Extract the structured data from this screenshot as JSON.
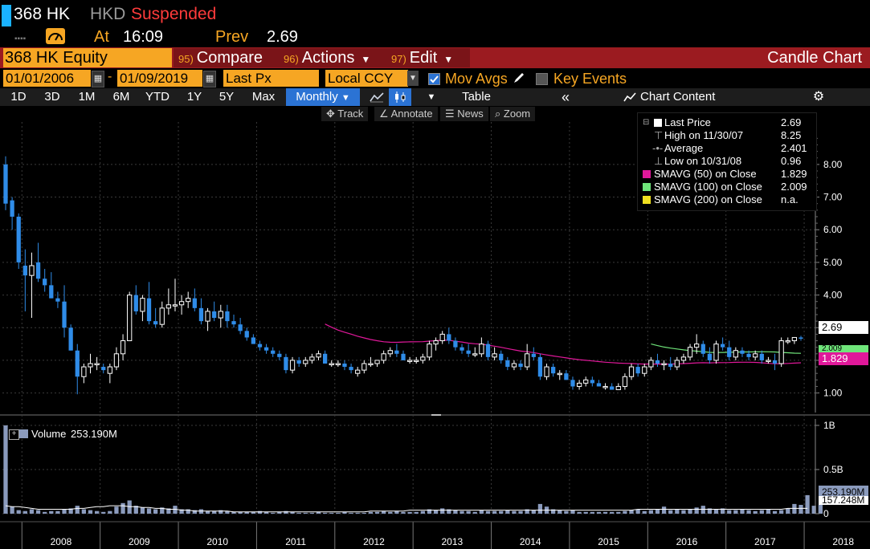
{
  "header": {
    "ticker": "368 HK",
    "currency": "HKD",
    "status": "Suspended",
    "at_label": "At",
    "time": "16:09",
    "prev_label": "Prev",
    "prev_value": "2.69",
    "status_color": "#ff3b3b"
  },
  "menu": {
    "security": "368 HK Equity",
    "compare_num": "95)",
    "compare": "Compare",
    "actions_num": "96)",
    "actions": "Actions",
    "edit_num": "97)",
    "edit": "Edit",
    "chart_title": "Candle Chart"
  },
  "controls": {
    "start_date": "01/01/2006",
    "dash": "-",
    "end_date": "01/09/2019",
    "price_field": "Last Px",
    "currency_field": "Local CCY",
    "mov_avgs": "Mov Avgs",
    "key_events": "Key Events"
  },
  "toolbar": {
    "ranges": [
      "1D",
      "3D",
      "1M",
      "6M",
      "YTD",
      "1Y",
      "5Y",
      "Max"
    ],
    "period": "Monthly",
    "table": "Table",
    "chart_content": "Chart Content"
  },
  "tools": {
    "track": "Track",
    "annotate": "Annotate",
    "news": "News",
    "zoom": "Zoom"
  },
  "legend": [
    {
      "label": "Last Price",
      "value": "2.69",
      "color": ""
    },
    {
      "label": "High on 11/30/07",
      "value": "8.25",
      "color": ""
    },
    {
      "label": "Average",
      "value": "2.401",
      "color": ""
    },
    {
      "label": "Low on 10/31/08",
      "value": "0.96",
      "color": ""
    },
    {
      "label": "SMAVG (50)  on Close",
      "value": "1.829",
      "color": "#e0189a"
    },
    {
      "label": "SMAVG (100)  on Close",
      "value": "2.009",
      "color": "#6fe57a"
    },
    {
      "label": "SMAVG (200)  on Close",
      "value": "n.a.",
      "color": "#f0e020"
    }
  ],
  "price_tags": {
    "last": "2.69",
    "sma100": "2.009",
    "sma50": "1.829"
  },
  "volume": {
    "label": "Volume",
    "value": "253.190M",
    "avg_tag": "157.248M",
    "axis": [
      "1B",
      "0.5B",
      "0"
    ]
  },
  "chart_data": {
    "type": "candlestick",
    "period": "Monthly",
    "y_axis_ticks": [
      "1.00",
      "2.00",
      "3.00",
      "4.00",
      "5.00",
      "6.00",
      "7.00",
      "8.00"
    ],
    "ylim": [
      0.4,
      9.3
    ],
    "x_labels": [
      "2008",
      "2009",
      "2010",
      "2011",
      "2012",
      "2013",
      "2014",
      "2015",
      "2016",
      "2017",
      "2018"
    ],
    "x_start": "2007-10",
    "candles": [
      {
        "o": 8.0,
        "h": 8.25,
        "l": 6.6,
        "c": 6.8
      },
      {
        "o": 6.9,
        "h": 7.0,
        "l": 6.0,
        "c": 6.4
      },
      {
        "o": 6.4,
        "h": 6.5,
        "l": 4.8,
        "c": 5.0
      },
      {
        "o": 4.9,
        "h": 5.4,
        "l": 3.5,
        "c": 4.6
      },
      {
        "o": 4.6,
        "h": 5.3,
        "l": 3.3,
        "c": 4.9
      },
      {
        "o": 5.0,
        "h": 5.6,
        "l": 4.4,
        "c": 4.5
      },
      {
        "o": 4.5,
        "h": 4.8,
        "l": 4.1,
        "c": 4.3
      },
      {
        "o": 4.3,
        "h": 4.7,
        "l": 3.9,
        "c": 3.9
      },
      {
        "o": 3.9,
        "h": 4.1,
        "l": 3.6,
        "c": 3.8
      },
      {
        "o": 3.8,
        "h": 4.3,
        "l": 2.7,
        "c": 3.0
      },
      {
        "o": 3.0,
        "h": 3.1,
        "l": 2.3,
        "c": 2.3
      },
      {
        "o": 2.3,
        "h": 2.5,
        "l": 0.96,
        "c": 1.5
      },
      {
        "o": 1.5,
        "h": 1.9,
        "l": 1.3,
        "c": 1.8
      },
      {
        "o": 1.8,
        "h": 2.2,
        "l": 1.6,
        "c": 1.9
      },
      {
        "o": 1.9,
        "h": 2.1,
        "l": 1.7,
        "c": 1.9
      },
      {
        "o": 1.8,
        "h": 1.9,
        "l": 1.6,
        "c": 1.7
      },
      {
        "o": 1.6,
        "h": 1.9,
        "l": 1.3,
        "c": 1.8
      },
      {
        "o": 1.8,
        "h": 2.4,
        "l": 1.7,
        "c": 2.2
      },
      {
        "o": 2.2,
        "h": 2.8,
        "l": 2.0,
        "c": 2.6
      },
      {
        "o": 2.6,
        "h": 4.1,
        "l": 2.6,
        "c": 4.0
      },
      {
        "o": 4.0,
        "h": 4.3,
        "l": 3.4,
        "c": 3.5
      },
      {
        "o": 3.5,
        "h": 4.0,
        "l": 3.2,
        "c": 3.9
      },
      {
        "o": 3.9,
        "h": 4.4,
        "l": 3.1,
        "c": 3.2
      },
      {
        "o": 3.2,
        "h": 3.6,
        "l": 3.0,
        "c": 3.1
      },
      {
        "o": 3.1,
        "h": 3.8,
        "l": 3.0,
        "c": 3.6
      },
      {
        "o": 3.6,
        "h": 4.2,
        "l": 3.4,
        "c": 3.7
      },
      {
        "o": 3.7,
        "h": 4.5,
        "l": 3.5,
        "c": 3.7
      },
      {
        "o": 3.7,
        "h": 4.0,
        "l": 3.4,
        "c": 3.8
      },
      {
        "o": 3.8,
        "h": 4.1,
        "l": 3.6,
        "c": 3.9
      },
      {
        "o": 3.9,
        "h": 4.2,
        "l": 3.5,
        "c": 3.6
      },
      {
        "o": 3.6,
        "h": 3.9,
        "l": 3.1,
        "c": 3.2
      },
      {
        "o": 3.2,
        "h": 3.6,
        "l": 2.9,
        "c": 3.5
      },
      {
        "o": 3.5,
        "h": 3.8,
        "l": 3.2,
        "c": 3.3
      },
      {
        "o": 3.3,
        "h": 3.7,
        "l": 3.0,
        "c": 3.5
      },
      {
        "o": 3.5,
        "h": 3.7,
        "l": 3.0,
        "c": 3.2
      },
      {
        "o": 3.2,
        "h": 3.4,
        "l": 3.0,
        "c": 3.1
      },
      {
        "o": 3.1,
        "h": 3.3,
        "l": 2.8,
        "c": 2.9
      },
      {
        "o": 2.9,
        "h": 3.0,
        "l": 2.6,
        "c": 2.7
      },
      {
        "o": 2.7,
        "h": 2.8,
        "l": 2.5,
        "c": 2.5
      },
      {
        "o": 2.5,
        "h": 2.6,
        "l": 2.3,
        "c": 2.4
      },
      {
        "o": 2.4,
        "h": 2.5,
        "l": 2.2,
        "c": 2.3
      },
      {
        "o": 2.3,
        "h": 2.4,
        "l": 2.1,
        "c": 2.2
      },
      {
        "o": 2.2,
        "h": 2.3,
        "l": 2.0,
        "c": 2.1
      },
      {
        "o": 2.1,
        "h": 2.2,
        "l": 1.6,
        "c": 1.7
      },
      {
        "o": 1.7,
        "h": 2.1,
        "l": 1.6,
        "c": 2.0
      },
      {
        "o": 2.0,
        "h": 2.1,
        "l": 1.8,
        "c": 1.9
      },
      {
        "o": 1.9,
        "h": 2.1,
        "l": 1.8,
        "c": 2.0
      },
      {
        "o": 2.0,
        "h": 2.2,
        "l": 1.9,
        "c": 2.1
      },
      {
        "o": 2.1,
        "h": 2.3,
        "l": 2.0,
        "c": 2.2
      },
      {
        "o": 2.2,
        "h": 2.3,
        "l": 1.9,
        "c": 1.9
      },
      {
        "o": 1.9,
        "h": 2.0,
        "l": 1.8,
        "c": 1.9
      },
      {
        "o": 1.9,
        "h": 2.0,
        "l": 1.8,
        "c": 1.9
      },
      {
        "o": 1.9,
        "h": 2.0,
        "l": 1.7,
        "c": 1.8
      },
      {
        "o": 1.8,
        "h": 1.9,
        "l": 1.6,
        "c": 1.7
      },
      {
        "o": 1.6,
        "h": 1.8,
        "l": 1.5,
        "c": 1.7
      },
      {
        "o": 1.7,
        "h": 2.0,
        "l": 1.6,
        "c": 1.9
      },
      {
        "o": 1.9,
        "h": 2.1,
        "l": 1.8,
        "c": 1.9
      },
      {
        "o": 1.9,
        "h": 2.0,
        "l": 1.8,
        "c": 2.0
      },
      {
        "o": 2.0,
        "h": 2.3,
        "l": 1.9,
        "c": 2.2
      },
      {
        "o": 2.2,
        "h": 2.4,
        "l": 2.1,
        "c": 2.3
      },
      {
        "o": 2.3,
        "h": 2.5,
        "l": 2.1,
        "c": 2.2
      },
      {
        "o": 2.2,
        "h": 2.3,
        "l": 2.0,
        "c": 2.0
      },
      {
        "o": 2.0,
        "h": 2.1,
        "l": 1.9,
        "c": 2.0
      },
      {
        "o": 2.0,
        "h": 2.1,
        "l": 1.9,
        "c": 2.0
      },
      {
        "o": 2.0,
        "h": 2.2,
        "l": 1.9,
        "c": 2.1
      },
      {
        "o": 2.1,
        "h": 2.6,
        "l": 2.0,
        "c": 2.5
      },
      {
        "o": 2.5,
        "h": 2.7,
        "l": 2.3,
        "c": 2.6
      },
      {
        "o": 2.6,
        "h": 2.9,
        "l": 2.5,
        "c": 2.8
      },
      {
        "o": 2.8,
        "h": 3.0,
        "l": 2.5,
        "c": 2.6
      },
      {
        "o": 2.6,
        "h": 2.7,
        "l": 2.3,
        "c": 2.4
      },
      {
        "o": 2.4,
        "h": 2.5,
        "l": 2.2,
        "c": 2.3
      },
      {
        "o": 2.3,
        "h": 2.5,
        "l": 2.1,
        "c": 2.2
      },
      {
        "o": 2.2,
        "h": 2.4,
        "l": 2.1,
        "c": 2.2
      },
      {
        "o": 2.2,
        "h": 2.7,
        "l": 2.1,
        "c": 2.5
      },
      {
        "o": 2.5,
        "h": 2.6,
        "l": 2.0,
        "c": 2.1
      },
      {
        "o": 2.1,
        "h": 2.4,
        "l": 2.0,
        "c": 2.2
      },
      {
        "o": 2.2,
        "h": 2.3,
        "l": 1.9,
        "c": 2.0
      },
      {
        "o": 2.0,
        "h": 2.1,
        "l": 1.7,
        "c": 1.8
      },
      {
        "o": 1.8,
        "h": 2.0,
        "l": 1.7,
        "c": 1.9
      },
      {
        "o": 1.9,
        "h": 2.0,
        "l": 1.7,
        "c": 1.8
      },
      {
        "o": 1.8,
        "h": 2.5,
        "l": 1.7,
        "c": 2.2
      },
      {
        "o": 2.2,
        "h": 2.4,
        "l": 2.0,
        "c": 2.1
      },
      {
        "o": 2.1,
        "h": 2.2,
        "l": 1.4,
        "c": 1.5
      },
      {
        "o": 1.5,
        "h": 1.9,
        "l": 1.4,
        "c": 1.8
      },
      {
        "o": 1.8,
        "h": 1.9,
        "l": 1.5,
        "c": 1.6
      },
      {
        "o": 1.6,
        "h": 1.7,
        "l": 1.4,
        "c": 1.6
      },
      {
        "o": 1.6,
        "h": 1.7,
        "l": 1.4,
        "c": 1.4
      },
      {
        "o": 1.4,
        "h": 1.5,
        "l": 1.1,
        "c": 1.2
      },
      {
        "o": 1.2,
        "h": 1.4,
        "l": 1.1,
        "c": 1.3
      },
      {
        "o": 1.3,
        "h": 1.5,
        "l": 1.2,
        "c": 1.4
      },
      {
        "o": 1.4,
        "h": 1.5,
        "l": 1.2,
        "c": 1.3
      },
      {
        "o": 1.3,
        "h": 1.4,
        "l": 1.2,
        "c": 1.2
      },
      {
        "o": 1.2,
        "h": 1.3,
        "l": 1.1,
        "c": 1.2
      },
      {
        "o": 1.2,
        "h": 1.3,
        "l": 1.1,
        "c": 1.1
      },
      {
        "o": 1.1,
        "h": 1.3,
        "l": 1.1,
        "c": 1.2
      },
      {
        "o": 1.2,
        "h": 1.6,
        "l": 1.1,
        "c": 1.5
      },
      {
        "o": 1.5,
        "h": 1.9,
        "l": 1.4,
        "c": 1.8
      },
      {
        "o": 1.8,
        "h": 1.9,
        "l": 1.5,
        "c": 1.6
      },
      {
        "o": 1.6,
        "h": 1.9,
        "l": 1.5,
        "c": 1.8
      },
      {
        "o": 1.8,
        "h": 2.1,
        "l": 1.7,
        "c": 2.0
      },
      {
        "o": 2.0,
        "h": 2.2,
        "l": 1.8,
        "c": 1.9
      },
      {
        "o": 1.9,
        "h": 2.0,
        "l": 1.7,
        "c": 1.9
      },
      {
        "o": 1.9,
        "h": 2.1,
        "l": 1.7,
        "c": 1.8
      },
      {
        "o": 1.8,
        "h": 2.1,
        "l": 1.7,
        "c": 2.0
      },
      {
        "o": 2.0,
        "h": 2.2,
        "l": 1.9,
        "c": 2.1
      },
      {
        "o": 2.1,
        "h": 2.5,
        "l": 2.0,
        "c": 2.4
      },
      {
        "o": 2.4,
        "h": 2.8,
        "l": 2.2,
        "c": 2.5
      },
      {
        "o": 2.5,
        "h": 2.6,
        "l": 2.1,
        "c": 2.2
      },
      {
        "o": 2.2,
        "h": 2.4,
        "l": 1.9,
        "c": 2.0
      },
      {
        "o": 2.0,
        "h": 2.6,
        "l": 1.9,
        "c": 2.5
      },
      {
        "o": 2.5,
        "h": 2.7,
        "l": 2.3,
        "c": 2.4
      },
      {
        "o": 2.4,
        "h": 2.6,
        "l": 2.0,
        "c": 2.1
      },
      {
        "o": 2.1,
        "h": 2.4,
        "l": 2.0,
        "c": 2.3
      },
      {
        "o": 2.3,
        "h": 2.4,
        "l": 2.1,
        "c": 2.2
      },
      {
        "o": 2.2,
        "h": 2.3,
        "l": 2.0,
        "c": 2.1
      },
      {
        "o": 2.1,
        "h": 2.3,
        "l": 2.0,
        "c": 2.2
      },
      {
        "o": 2.2,
        "h": 2.3,
        "l": 1.9,
        "c": 2.0
      },
      {
        "o": 2.0,
        "h": 2.1,
        "l": 1.9,
        "c": 2.0
      },
      {
        "o": 2.0,
        "h": 2.2,
        "l": 1.7,
        "c": 1.9
      },
      {
        "o": 1.9,
        "h": 2.7,
        "l": 1.8,
        "c": 2.6
      },
      {
        "o": 2.6,
        "h": 2.7,
        "l": 2.5,
        "c": 2.6
      },
      {
        "o": 2.6,
        "h": 2.7,
        "l": 2.5,
        "c": 2.7
      },
      {
        "o": 2.7,
        "h": 2.75,
        "l": 2.6,
        "c": 2.69
      }
    ],
    "volume_series": [
      1.0,
      0.08,
      0.04,
      0.03,
      0.05,
      0.04,
      0.02,
      0.03,
      0.03,
      0.05,
      0.06,
      0.09,
      0.05,
      0.04,
      0.03,
      0.02,
      0.03,
      0.08,
      0.12,
      0.15,
      0.09,
      0.07,
      0.06,
      0.05,
      0.07,
      0.06,
      0.09,
      0.05,
      0.05,
      0.04,
      0.05,
      0.03,
      0.03,
      0.04,
      0.03,
      0.02,
      0.02,
      0.02,
      0.02,
      0.03,
      0.02,
      0.01,
      0.02,
      0.03,
      0.02,
      0.01,
      0.01,
      0.01,
      0.02,
      0.01,
      0.01,
      0.01,
      0.02,
      0.01,
      0.01,
      0.01,
      0.02,
      0.02,
      0.03,
      0.02,
      0.03,
      0.02,
      0.02,
      0.02,
      0.03,
      0.05,
      0.04,
      0.06,
      0.05,
      0.04,
      0.03,
      0.03,
      0.02,
      0.04,
      0.03,
      0.03,
      0.03,
      0.04,
      0.03,
      0.03,
      0.05,
      0.04,
      0.11,
      0.08,
      0.05,
      0.04,
      0.03,
      0.04,
      0.02,
      0.02,
      0.02,
      0.02,
      0.02,
      0.02,
      0.02,
      0.03,
      0.04,
      0.05,
      0.03,
      0.04,
      0.05,
      0.08,
      0.04,
      0.05,
      0.04,
      0.05,
      0.07,
      0.09,
      0.06,
      0.05,
      0.06,
      0.04,
      0.04,
      0.05,
      0.04,
      0.03,
      0.04,
      0.05,
      0.03,
      0.04,
      0.06,
      0.11,
      0.1,
      0.21,
      0.09,
      0.1
    ],
    "volume_avg_series": [
      0.09,
      0.08,
      0.08,
      0.07,
      0.06,
      0.05,
      0.05,
      0.05,
      0.05,
      0.05,
      0.05,
      0.06,
      0.06,
      0.07,
      0.08,
      0.08,
      0.09,
      0.09,
      0.09,
      0.08,
      0.08,
      0.07,
      0.07,
      0.06,
      0.06,
      0.05,
      0.05,
      0.04,
      0.04,
      0.03,
      0.03,
      0.03,
      0.03,
      0.03,
      0.03,
      0.02,
      0.02,
      0.02,
      0.02,
      0.02,
      0.02,
      0.02,
      0.02,
      0.02,
      0.02,
      0.02,
      0.02,
      0.02,
      0.02,
      0.02,
      0.02,
      0.02,
      0.02,
      0.02,
      0.02,
      0.02,
      0.03,
      0.03,
      0.03,
      0.03,
      0.03,
      0.03,
      0.04,
      0.04,
      0.04,
      0.04,
      0.04,
      0.04,
      0.04,
      0.04,
      0.04,
      0.04,
      0.04,
      0.04,
      0.04,
      0.04,
      0.04,
      0.04,
      0.04,
      0.04,
      0.04,
      0.04,
      0.04,
      0.04,
      0.04,
      0.04,
      0.04,
      0.04,
      0.04,
      0.04,
      0.04,
      0.04,
      0.04,
      0.04,
      0.04,
      0.04,
      0.04,
      0.05,
      0.05,
      0.05,
      0.05,
      0.05,
      0.05,
      0.05,
      0.05,
      0.05,
      0.05,
      0.05,
      0.05,
      0.05,
      0.05,
      0.05,
      0.05,
      0.05,
      0.05,
      0.05,
      0.05,
      0.05,
      0.05,
      0.05,
      0.06,
      0.06,
      0.06,
      0.06
    ],
    "sma50_color": "#e0189a",
    "sma100_color": "#6fe57a"
  }
}
